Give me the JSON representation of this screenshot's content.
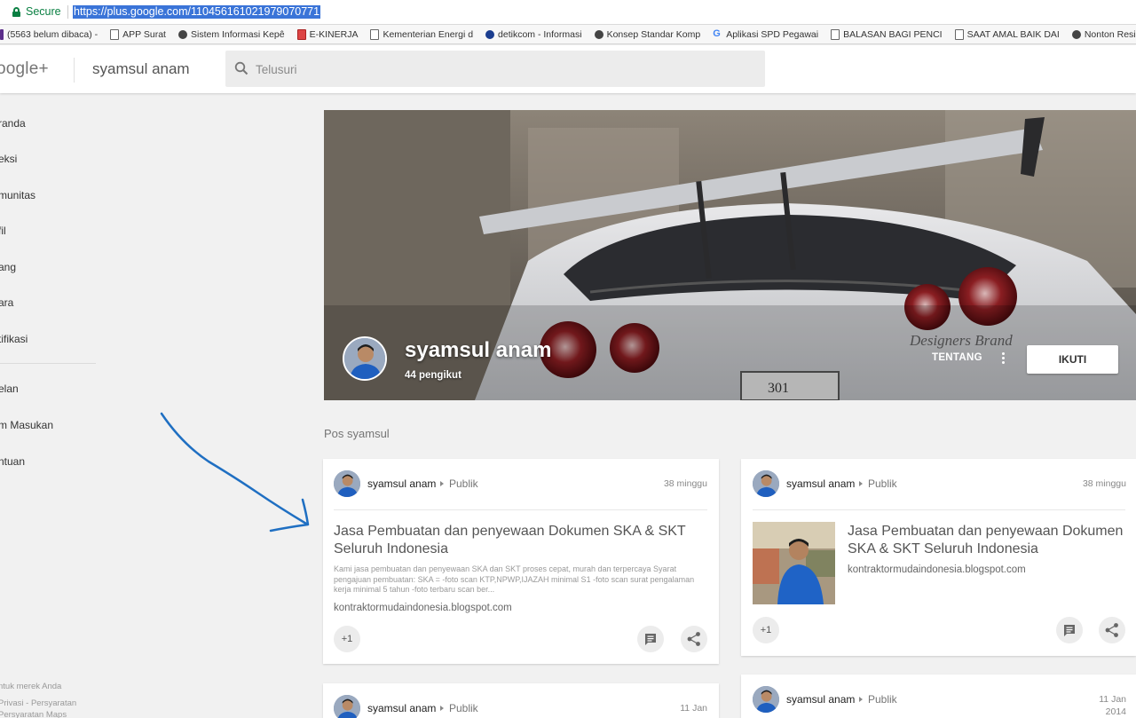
{
  "browser": {
    "secure_label": "Secure",
    "url": "https://plus.google.com/110456161021979070771"
  },
  "bookmarks": [
    {
      "label": "(5563 belum dibaca) -",
      "icon": "mail-icon"
    },
    {
      "label": "APP Surat",
      "icon": "page-icon"
    },
    {
      "label": "Sistem Informasi Kepê",
      "icon": "emblem-icon"
    },
    {
      "label": "E-KINERJA",
      "icon": "ekinerja-icon"
    },
    {
      "label": "Kementerian Energi d",
      "icon": "page-icon"
    },
    {
      "label": "detikcom - Informasi",
      "icon": "detik-icon"
    },
    {
      "label": "Konsep Standar Komp",
      "icon": "emblem-icon"
    },
    {
      "label": "Aplikasi SPD Pegawai",
      "icon": "google-icon"
    },
    {
      "label": "BALASAN BAGI PENCI",
      "icon": "page-icon"
    },
    {
      "label": "SAAT AMAL BAIK DAI",
      "icon": "page-icon"
    },
    {
      "label": "Nonton Resident Evil",
      "icon": "film-icon"
    }
  ],
  "header": {
    "logo": "oogle+",
    "title": "syamsul anam",
    "search_placeholder": "Telusuri"
  },
  "sidebar": {
    "items": [
      "randa",
      "eksi",
      "munitas",
      "fil",
      "ang",
      "ara",
      "tifikasi"
    ],
    "items2": [
      "elan",
      "m Masukan",
      "ntuan"
    ],
    "footer": [
      "ntuk merek Anda",
      "Privasi - Persyaratan",
      "Persyaratan Maps"
    ]
  },
  "profile": {
    "name": "syamsul anam",
    "followers": "44 pengikut",
    "about_label": "TENTANG",
    "follow_label": "IKUTI",
    "cover_watermark": "Designers Brand"
  },
  "posts_section_title": "Pos syamsul",
  "posts": [
    {
      "author": "syamsul anam",
      "visibility": "Publik",
      "time": "38 minggu",
      "title": "Jasa Pembuatan dan penyewaan Dokumen SKA & SKT Seluruh Indonesia",
      "description": "Kami jasa pembuatan dan penyewaan SKA dan SKT proses cepat, murah dan terpercaya Syarat pengajuan pembuatan: SKA = -foto scan KTP,NPWP,IJAZAH minimal S1 -foto scan surat pengalaman kerja minimal 5 tahun -foto terbaru scan ber...",
      "domain": "kontraktormudaindonesia.blogspot.com",
      "plus_one": "+1"
    },
    {
      "author": "syamsul anam",
      "visibility": "Publik",
      "time": "38 minggu",
      "title": "Jasa Pembuatan dan penyewaan Dokumen SKA & SKT Seluruh Indonesia",
      "domain": "kontraktormudaindonesia.blogspot.com",
      "plus_one": "+1"
    },
    {
      "author": "syamsul anam",
      "visibility": "Publik",
      "time": "11 Jan"
    },
    {
      "author": "syamsul anam",
      "visibility": "Publik",
      "time": "11 Jan",
      "time2": "2014"
    }
  ],
  "colors": {
    "page_bg": "#f1f1f1",
    "secure_green": "#0b8043",
    "url_highlight": "#3a74d8",
    "annotation_arrow": "#1f6fc2"
  }
}
